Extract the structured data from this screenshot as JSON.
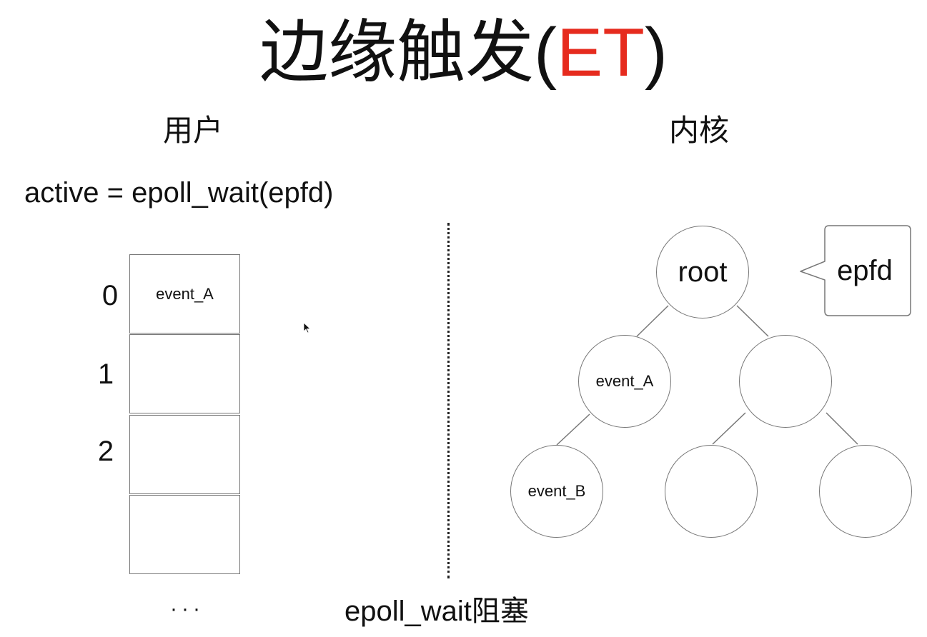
{
  "title": {
    "main": "边缘触发(",
    "accent": "ET",
    "close": ")",
    "accent_color": "#e62b1e"
  },
  "sections": {
    "user": "用户",
    "kernel": "内核"
  },
  "code": "active = epoll_wait(epfd)",
  "active_array": {
    "indices": [
      "0",
      "1",
      "2"
    ],
    "slots": [
      "event_A",
      "",
      "",
      ""
    ],
    "ellipsis": "···"
  },
  "tree": {
    "root": "root",
    "callout": "epfd",
    "nodes": {
      "left": "event_A",
      "right": "",
      "left_left": "event_B",
      "right_left": "",
      "right_right": ""
    }
  },
  "caption": "epoll_wait阻塞"
}
